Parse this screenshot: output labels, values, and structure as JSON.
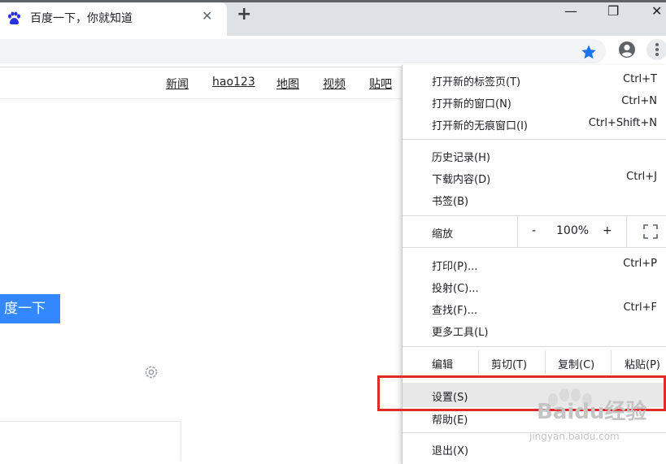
{
  "tab": {
    "title": "百度一下，你就知道",
    "close": "✕"
  },
  "newtab": "+",
  "window_controls": {
    "minimize": "—",
    "maximize": "❐",
    "close": "✕"
  },
  "colors": {
    "accent": "#1a73e8",
    "baidu_blue": "#3388ff",
    "highlight": "#e02a2a"
  },
  "page": {
    "nav": [
      "新闻",
      "hao123",
      "地图",
      "视频",
      "贴吧"
    ],
    "search_button": "度一下"
  },
  "menu": {
    "group1": [
      {
        "label": "打开新的标签页(T)",
        "shortcut": "Ctrl+T"
      },
      {
        "label": "打开新的窗口(N)",
        "shortcut": "Ctrl+N"
      },
      {
        "label": "打开新的无痕窗口(I)",
        "shortcut": "Ctrl+Shift+N"
      }
    ],
    "group2": [
      {
        "label": "历史记录(H)",
        "shortcut": ""
      },
      {
        "label": "下载内容(D)",
        "shortcut": "Ctrl+J"
      },
      {
        "label": "书签(B)",
        "shortcut": ""
      }
    ],
    "zoom": {
      "label": "缩放",
      "minus": "-",
      "value": "100%",
      "plus": "+"
    },
    "group3": [
      {
        "label": "打印(P)...",
        "shortcut": "Ctrl+P"
      },
      {
        "label": "投射(C)...",
        "shortcut": ""
      },
      {
        "label": "查找(F)...",
        "shortcut": "Ctrl+F"
      },
      {
        "label": "更多工具(L)",
        "shortcut": ""
      }
    ],
    "edit": {
      "label": "编辑",
      "cut": "剪切(T)",
      "copy": "复制(C)",
      "paste": "粘贴(P)"
    },
    "settings": "设置(S)",
    "help": "帮助(E)",
    "exit": "退出(X)"
  },
  "watermark": {
    "text": "Baidu经验",
    "url": "jingyan.baidu.com"
  }
}
